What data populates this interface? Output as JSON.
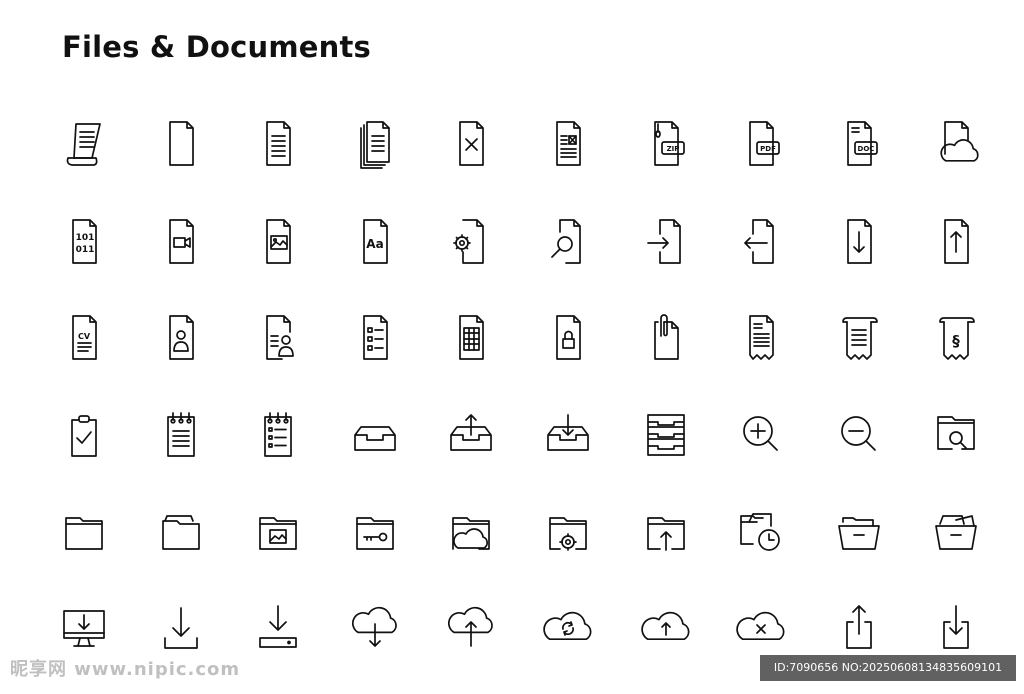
{
  "title": "Files & Documents",
  "icons": [
    [
      "scroll-document-icon",
      "blank-file-icon",
      "text-file-icon",
      "multiple-files-icon",
      "delete-file-icon",
      "file-image-text-icon",
      "zip-file-icon",
      "pdf-file-icon",
      "doc-file-icon",
      "cloud-file-icon"
    ],
    [
      "binary-file-icon",
      "video-file-icon",
      "image-file-icon",
      "font-file-icon",
      "settings-file-icon",
      "search-file-icon",
      "import-file-icon",
      "export-file-icon",
      "download-file-icon",
      "upload-file-icon"
    ],
    [
      "cv-file-icon",
      "user-file-icon",
      "contact-file-icon",
      "checklist-file-icon",
      "spreadsheet-file-icon",
      "locked-file-icon",
      "attachment-file-icon",
      "receipt-icon",
      "scroll-receipt-icon",
      "legal-document-icon"
    ],
    [
      "clipboard-check-icon",
      "notepad-icon",
      "notepad-list-icon",
      "inbox-tray-icon",
      "outbox-tray-icon",
      "inbox-download-icon",
      "stacked-trays-icon",
      "zoom-in-icon",
      "zoom-out-icon",
      "folder-search-icon"
    ],
    [
      "folder-icon",
      "folder-documents-icon",
      "image-folder-icon",
      "key-folder-icon",
      "cloud-folder-icon",
      "settings-folder-icon",
      "upload-folder-icon",
      "recent-files-icon",
      "open-folder-icon",
      "open-folder-documents-icon"
    ],
    [
      "monitor-download-icon",
      "download-icon",
      "drive-download-icon",
      "cloud-download-icon",
      "cloud-upload-icon",
      "cloud-sync-icon",
      "cloud-upload-circle-icon",
      "cloud-error-icon",
      "share-icon",
      "import-icon"
    ]
  ],
  "labels": {
    "zip": "ZIP",
    "pdf": "PDF",
    "doc": "DOC",
    "binary_top": "101",
    "binary_bottom": "011",
    "font": "Aa",
    "cv": "CV",
    "section": "§"
  },
  "watermark": {
    "left": "昵享网 www.nipic.com",
    "right": "ID:7090656 NO:20250608134835609101"
  }
}
